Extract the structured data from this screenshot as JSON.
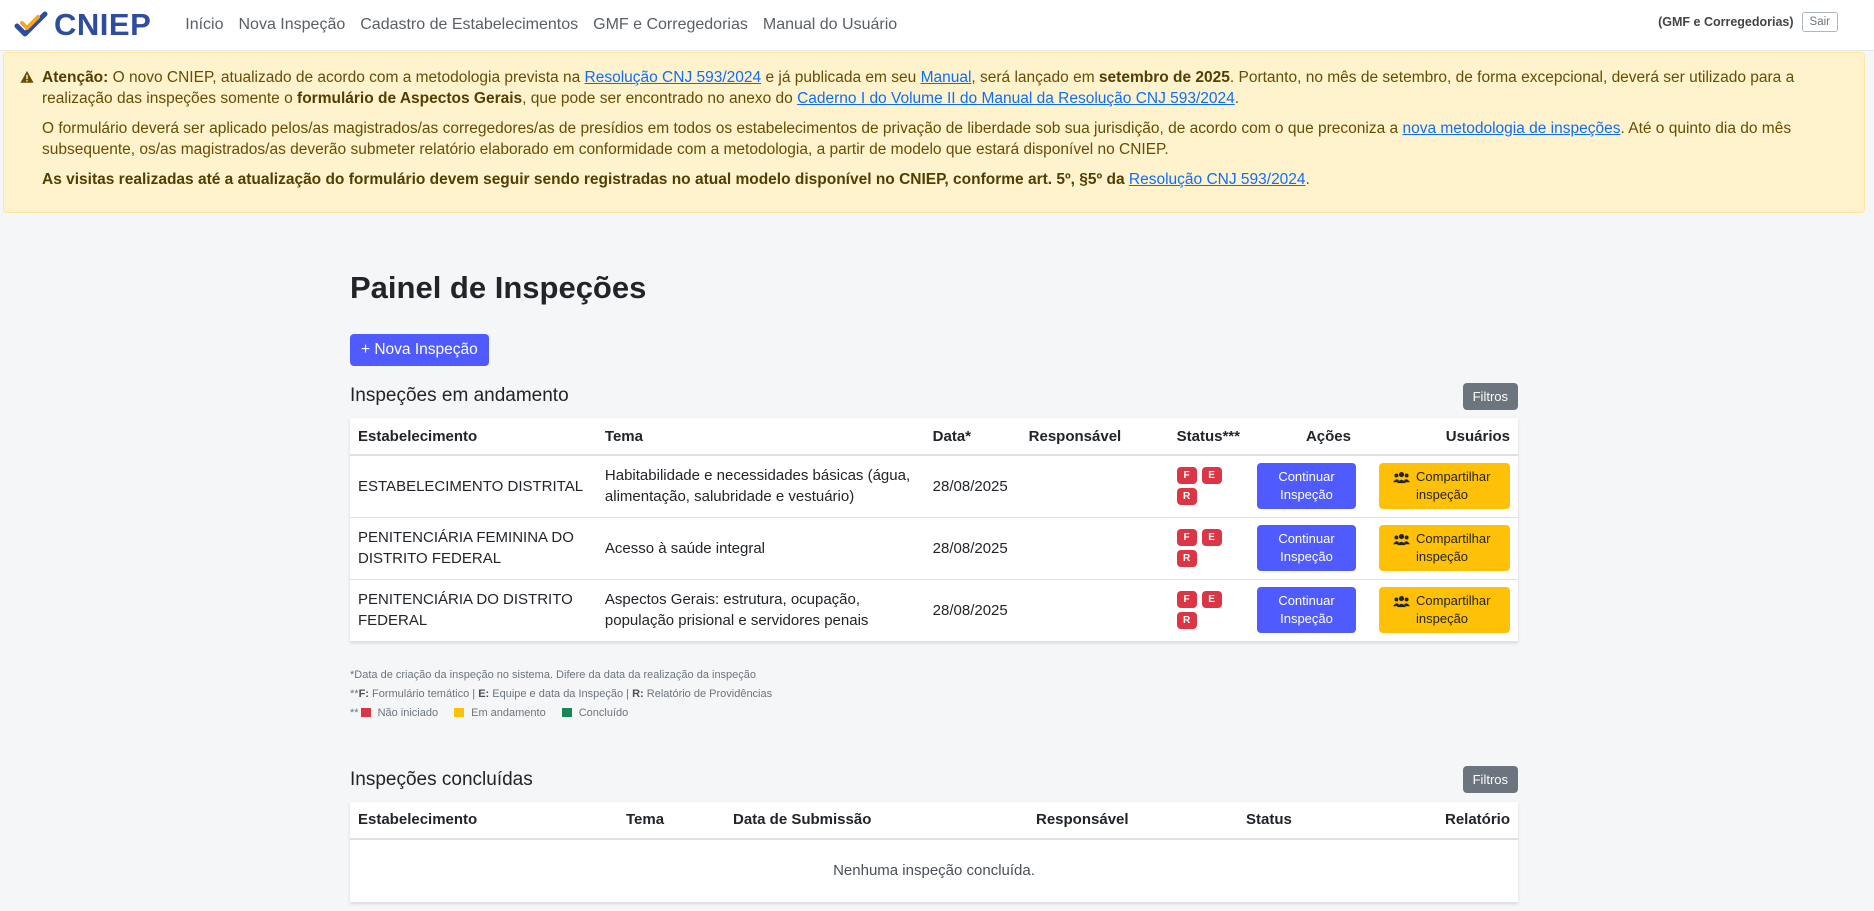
{
  "brand": {
    "name": "CNIEP"
  },
  "nav": {
    "links": [
      "Início",
      "Nova Inspeção",
      "Cadastro de Estabelecimentos",
      "GMF e Corregedorias",
      "Manual do Usuário"
    ],
    "user": "(GMF e Corregedorias)",
    "logout": "Sair"
  },
  "alert": {
    "p1": {
      "lead": "Atenção:",
      "t1": " O novo CNIEP, atualizado de acordo com a metodologia prevista na ",
      "link1": "Resolução CNJ 593/2024",
      "t2": " e já publicada em seu ",
      "link2": "Manual",
      "t3": ", será lançado em ",
      "bold1": "setembro de 2025",
      "t4": ". Portanto, no mês de setembro, de forma excepcional, deverá ser utilizado para a realização das inspeções somente o ",
      "bold2": "formulário de Aspectos Gerais",
      "t5": ", que pode ser encontrado no anexo do ",
      "link3": "Caderno I do Volume II do Manual da Resolução CNJ 593/2024",
      "t6": "."
    },
    "p2": {
      "t1": "O formulário deverá ser aplicado pelos/as magistrados/as corregedores/as de presídios em todos os estabelecimentos de privação de liberdade sob sua jurisdição, de acordo com o que preconiza a ",
      "link1": "nova metodologia de inspeções",
      "t2": ". Até o quinto dia do mês subsequente, os/as magistrados/as deverão submeter relatório elaborado em conformidade com a metodologia, a partir de modelo que estará disponível no CNIEP."
    },
    "p3": {
      "bold": "As visitas realizadas até a atualização do formulário devem seguir sendo registradas no atual modelo disponível no CNIEP, conforme art. 5º, §5º da",
      "space": " ",
      "link1": "Resolução CNJ 593/2024",
      "t1": "."
    }
  },
  "page": {
    "title": "Painel de Inspeções",
    "new_button": "+ Nova Inspeção"
  },
  "ongoing": {
    "title": "Inspeções em andamento",
    "filter": "Filtros",
    "headers": [
      "Estabelecimento",
      "Tema",
      "Data*",
      "Responsável",
      "Status***",
      "Ações",
      "Usuários"
    ],
    "rows": [
      {
        "estab": "ESTABELECIMENTO DISTRITAL",
        "tema": "Habitabilidade e necessidades básicas (água, alimentação, salubridade e vestuário)",
        "data": "28/08/2025",
        "resp": "",
        "badges": [
          "F",
          "E",
          "R"
        ],
        "action": "Continuar Inspeção",
        "share": "Compartilhar inspeção"
      },
      {
        "estab": "PENITENCIÁRIA FEMININA DO DISTRITO FEDERAL",
        "tema": "Acesso à saúde integral",
        "data": "28/08/2025",
        "resp": "",
        "badges": [
          "F",
          "E",
          "R"
        ],
        "action": "Continuar Inspeção",
        "share": "Compartilhar inspeção"
      },
      {
        "estab": "PENITENCIÁRIA DO DISTRITO FEDERAL",
        "tema": "Aspectos Gerais: estrutura, ocupação, população prisional e servidores penais",
        "data": "28/08/2025",
        "resp": "",
        "badges": [
          "F",
          "E",
          "R"
        ],
        "action": "Continuar Inspeção",
        "share": "Compartilhar inspeção"
      }
    ],
    "status_color": "#dc3545"
  },
  "footnotes": {
    "line1": "*Data de criação da inspeção no sistema. Difere da data da realização da inspeção",
    "line2_prefix": "**",
    "line2": [
      {
        "key": "F:",
        "text": " Formulário temático | "
      },
      {
        "key": "E:",
        "text": " Equipe e data da Inspeção | "
      },
      {
        "key": "R:",
        "text": " Relatório de Providências"
      }
    ],
    "legend_prefix": "**",
    "legend": [
      {
        "label": "Não iniciado",
        "color": "#dc3545"
      },
      {
        "label": "Em andamento",
        "color": "#ffc107"
      },
      {
        "label": "Concluído",
        "color": "#198754"
      }
    ]
  },
  "completed": {
    "title": "Inspeções concluídas",
    "filter": "Filtros",
    "headers": [
      "Estabelecimento",
      "Tema",
      "Data de Submissão",
      "Responsável",
      "Status",
      "Relatório"
    ],
    "empty": "Nenhuma inspeção concluída."
  },
  "colors": {
    "primary": "#4f5bff",
    "warning": "#ffc107",
    "secondary": "#6c757d",
    "brand": "#2f4d9e"
  }
}
